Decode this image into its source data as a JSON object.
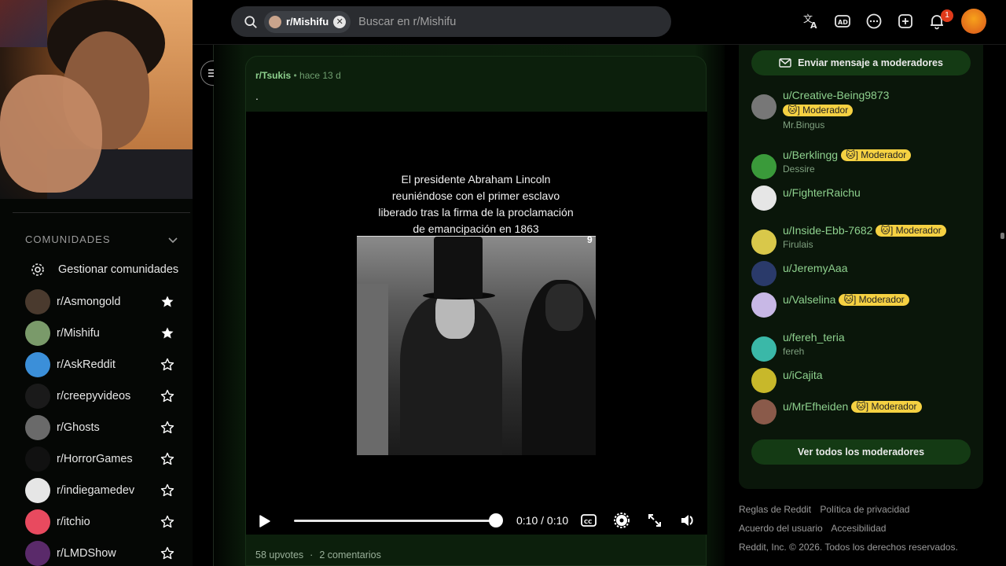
{
  "topbar": {
    "chip_label": "r/Mishifu",
    "search_placeholder": "Buscar en r/Mishifu",
    "notif_count": "1"
  },
  "sidebar": {
    "section_title": "COMUNIDADES",
    "manage_label": "Gestionar comunidades",
    "communities": [
      {
        "name": "r/Asmongold",
        "favorite": true,
        "color": "#4a3a2e"
      },
      {
        "name": "r/Mishifu",
        "favorite": true,
        "color": "#7a9a6a"
      },
      {
        "name": "r/AskReddit",
        "favorite": false,
        "color": "#3b8fd9"
      },
      {
        "name": "r/creepyvideos",
        "favorite": false,
        "color": "#1a1a1a"
      },
      {
        "name": "r/Ghosts",
        "favorite": false,
        "color": "#6a6a6a"
      },
      {
        "name": "r/HorrorGames",
        "favorite": false,
        "color": "#111111"
      },
      {
        "name": "r/indiegamedev",
        "favorite": false,
        "color": "#e6e6e6"
      },
      {
        "name": "r/itchio",
        "favorite": false,
        "color": "#e84a5f"
      },
      {
        "name": "r/LMDShow",
        "favorite": false,
        "color": "#5a2a6a"
      }
    ]
  },
  "post": {
    "subreddit": "r/Tsukis",
    "time": "hace 13 d",
    "title": ".",
    "video_caption": "El presidente Abraham Lincoln reuniéndose con el primer esclavo liberado tras la firma de la proclamación de emancipación en 1863",
    "frame_number": "9",
    "video_time": "0:10 / 0:10",
    "progress": 1.0,
    "upvotes": "58 upvotes",
    "separator": "·",
    "comments": "2 comentarios"
  },
  "right": {
    "message_mods": "Enviar mensaje a moderadores",
    "view_all_mods": "Ver todos los moderadores",
    "moderators": [
      {
        "name": "u/Creative-Being9873",
        "flair": "] Moderador",
        "sub": "Mr.Bingus",
        "flair_block": true,
        "color": "#777777"
      },
      {
        "name": "u/Berklingg",
        "flair": "] Moderador",
        "sub": "Dessire",
        "flair_block": false,
        "color": "#3a9a3a"
      },
      {
        "name": "u/FighterRaichu",
        "flair": "",
        "sub": "",
        "flair_block": false,
        "color": "#e6e6e6"
      },
      {
        "name": "u/Inside-Ebb-7682",
        "flair": "] Moderador",
        "sub": "Firulais",
        "flair_block": false,
        "color": "#d9c84a"
      },
      {
        "name": "u/JeremyAaa",
        "flair": "",
        "sub": "",
        "flair_block": false,
        "color": "#2a3a6a"
      },
      {
        "name": "u/Valselina",
        "flair": "] Moderador",
        "sub": "",
        "flair_block": false,
        "color": "#c8b8e6"
      },
      {
        "name": "u/fereh_teria",
        "flair": "",
        "sub": "fereh",
        "flair_block": false,
        "color": "#3ab8a8"
      },
      {
        "name": "u/iCajita",
        "flair": "",
        "sub": "",
        "flair_block": false,
        "color": "#c8b82a"
      },
      {
        "name": "u/MrEfheiden",
        "flair": "] Moderador",
        "sub": "",
        "flair_block": false,
        "color": "#8a5a4a"
      }
    ],
    "legal": {
      "rules": "Reglas de Reddit",
      "privacy": "Política de privacidad",
      "agreement": "Acuerdo del usuario",
      "accessibility": "Accesibilidad",
      "copyright": "Reddit, Inc. © 2026. Todos los derechos reservados."
    }
  }
}
